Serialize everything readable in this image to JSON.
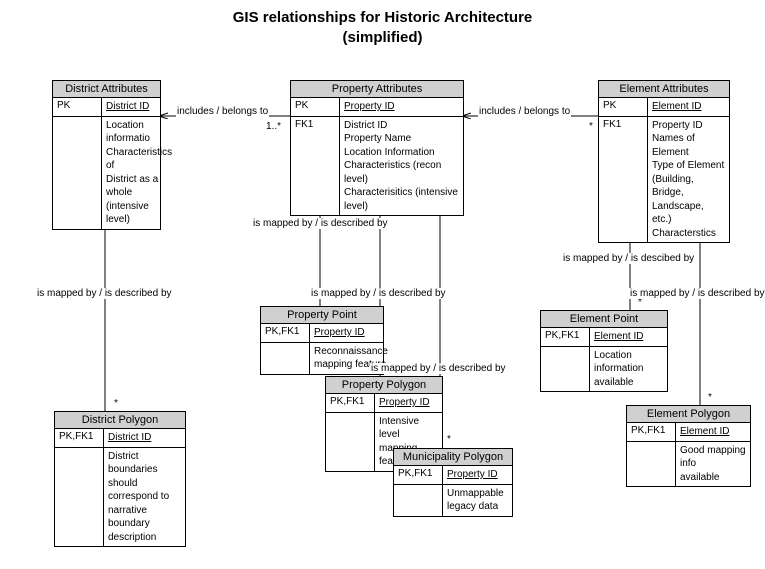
{
  "title_line1": "GIS relationships for Historic Architecture",
  "title_line2": "(simplified)",
  "entities": {
    "district_attr": {
      "header": "District Attributes",
      "pk_label": "PK",
      "pk_field": "District ID",
      "body": "Location informatio\nCharacteristics of\n District as a whole\n (intensive level)"
    },
    "property_attr": {
      "header": "Property Attributes",
      "pk_label": "PK",
      "pk_field": "Property ID",
      "fk_label": "FK1",
      "body": "District ID\nProperty Name\nLocation Information\nCharacteristics (recon level)\nCharacterisitics (intensive level)"
    },
    "element_attr": {
      "header": "Element Attributes",
      "pk_label": "PK",
      "pk_field": "Element ID",
      "fk_label": "FK1",
      "body": "Property ID\nNames of Element\nType of Element\n (Building, Bridge,\n Landscape, etc.)\nCharacterstics"
    },
    "district_polygon": {
      "header": "District Polygon",
      "key_label": "PK,FK1",
      "key_field": "District ID",
      "body": "District boundaries\n should correspond to\n narrative boundary\n description"
    },
    "property_point": {
      "header": "Property Point",
      "key_label": "PK,FK1",
      "key_field": "Property ID",
      "body": "Reconnaissance\n mapping feature"
    },
    "property_polygon": {
      "header": "Property Polygon",
      "key_label": "PK,FK1",
      "key_field": "Property ID",
      "body": "Intensive level\n mapping feature"
    },
    "municipality_polygon": {
      "header": "Municipality Polygon",
      "key_label": "PK,FK1",
      "key_field": "Property ID",
      "body": "Unmappable\n legacy data"
    },
    "element_point": {
      "header": "Element Point",
      "key_label": "PK,FK1",
      "key_field": "Element ID",
      "body": "Location information\n available"
    },
    "element_polygon": {
      "header": "Element Polygon",
      "key_label": "PK,FK1",
      "key_field": "Element ID",
      "body": "Good mapping info\n available"
    }
  },
  "relations": {
    "includes_belongs": "includes / belongs to",
    "mapped_described": "is mapped by / is described by",
    "mapped_descibed": "is mapped by / is descibed by",
    "one_many": "1..*",
    "many": "*"
  }
}
